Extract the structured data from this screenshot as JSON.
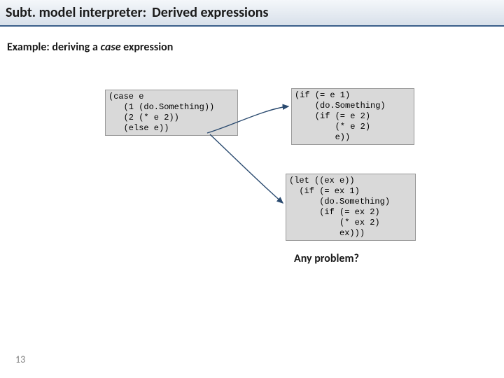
{
  "title": {
    "prefix": "Subt. model interpreter:",
    "main": "Derived expressions"
  },
  "subtitle_parts": {
    "lead": "Example: deriving a ",
    "em": "case",
    "tail": " expression"
  },
  "code": {
    "box1": "(case e\n   (1 (do.Something))\n   (2 (* e 2))\n   (else e))",
    "box2": "(if (= e 1)\n    (do.Something)\n    (if (= e 2)\n        (* e 2)\n        e))",
    "box3": "(let ((ex e))\n  (if (= ex 1)\n      (do.Something)\n      (if (= ex 2)\n          (* ex 2)\n          ex)))"
  },
  "any_problem": "Any problem?",
  "page_number": "13"
}
